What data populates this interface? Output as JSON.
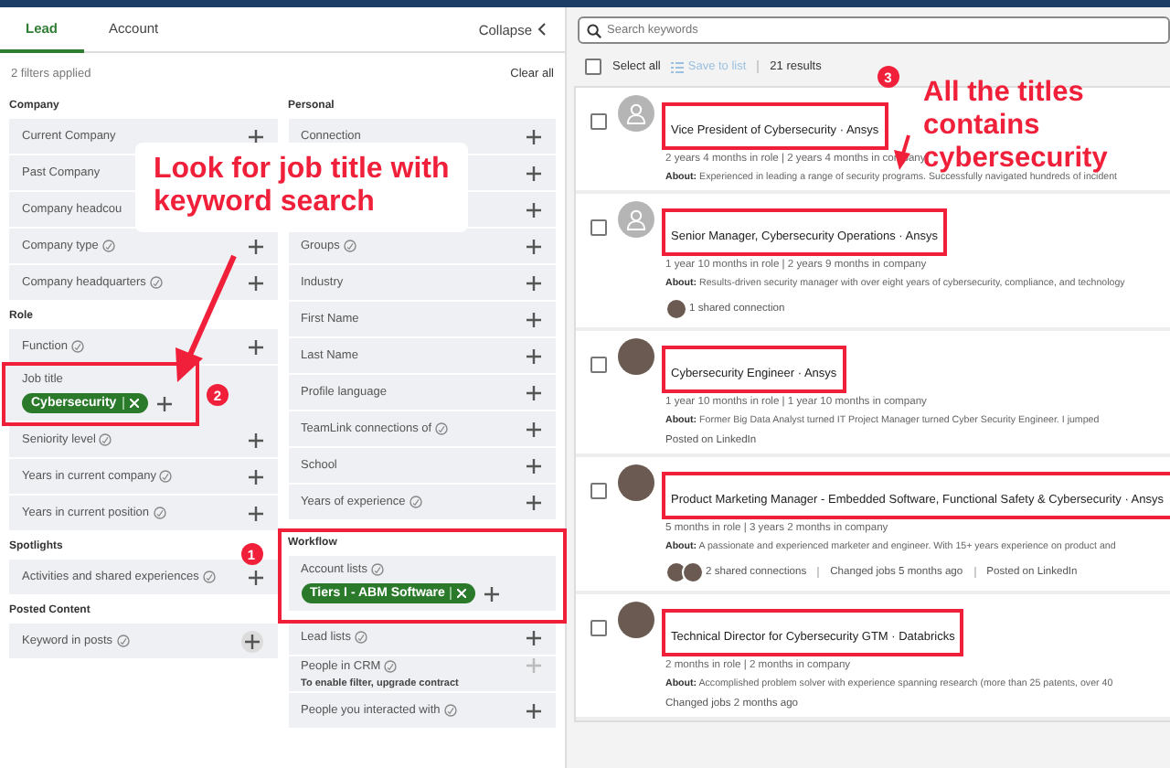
{
  "tabs": [
    {
      "label": "Lead",
      "selected": true
    },
    {
      "label": "Account",
      "selected": false
    }
  ],
  "collapse": "Collapse",
  "filters_applied": "2 filters applied",
  "clear_all": "Clear all",
  "left_column": [
    {
      "heading": "Company",
      "items": [
        {
          "label": "Current Company",
          "info": false
        },
        {
          "label": "Past Company",
          "info": false
        },
        {
          "label": "Company headcou",
          "info": false
        },
        {
          "label": "Company type",
          "info": true
        },
        {
          "label": "Company headquarters",
          "info": true
        }
      ]
    },
    {
      "heading": "Role",
      "items": [
        {
          "label": "Function",
          "info": true
        },
        {
          "label": "Job title",
          "info": false,
          "chips": [
            "Cybersecurity"
          ],
          "highlighted": true,
          "badge": "2"
        },
        {
          "label": "Seniority level",
          "info": true
        },
        {
          "label": "Years in current company",
          "info": true
        },
        {
          "label": "Years in current position",
          "info": true
        }
      ]
    },
    {
      "heading": "Spotlights",
      "items": [
        {
          "label": "Activities and shared experiences",
          "info": true
        }
      ]
    },
    {
      "heading": "Posted Content",
      "items": [
        {
          "label": "Keyword in posts",
          "info": true,
          "round_plus": true
        }
      ]
    }
  ],
  "right_column": [
    {
      "heading": "Personal",
      "items": [
        {
          "label": "Connection",
          "info": false
        },
        {
          "info": false
        },
        {
          "info": false
        },
        {
          "label": "Groups",
          "info": true
        },
        {
          "label": "Industry",
          "info": false
        },
        {
          "label": "First Name",
          "info": false
        },
        {
          "label": "Last Name",
          "info": false
        },
        {
          "label": "Profile language",
          "info": false
        },
        {
          "label": "TeamLink connections of",
          "info": true
        },
        {
          "label": "School",
          "info": false
        },
        {
          "label": "Years of experience",
          "info": true
        }
      ]
    },
    {
      "heading": "Workflow",
      "highlighted": true,
      "badge": "1",
      "items": [
        {
          "label": "Account lists",
          "info": true,
          "chips": [
            "Tiers I - ABM Software"
          ]
        },
        {
          "label": "Lead lists",
          "info": true
        },
        {
          "label": "People in CRM",
          "info": true,
          "disabled": true,
          "note": "To enable filter, upgrade contract"
        },
        {
          "label": "People you interacted with",
          "info": true
        }
      ]
    }
  ],
  "callout_left": "Look for job title with keyword search",
  "search": {
    "placeholder": "Search keywords"
  },
  "toolbar": {
    "select_all": "Select all",
    "checked": false,
    "save_to_list": "Save to list",
    "save_disabled": true,
    "results": "21 results"
  },
  "callout_right": "All the titles contains cybersecurity",
  "results": [
    {
      "avatar": {
        "kind": "generic"
      },
      "checked": false,
      "title": "Vice President of Cybersecurity · Ansys",
      "highlighted": true,
      "badge": "3",
      "tenure": "2 years 4 months in role | 2 years 4 months in company",
      "about": "**About:** Experienced in leading a range of security programs. Successfully navigated hundreds of incident"
    },
    {
      "avatar": {
        "kind": "generic"
      },
      "checked": false,
      "title": "Senior Manager, Cybersecurity Operations · Ansys",
      "highlighted": true,
      "tenure": "1 year 10 months in role | 2 years 9 months in company",
      "about": "**About:** Results-driven security manager with over eight years of cybersecurity, compliance, and technology",
      "footer": [
        {
          "kind": "connections",
          "avatars": [
            {
              "kind": "photo"
            }
          ],
          "text": "1 shared connection"
        }
      ]
    },
    {
      "avatar": {
        "kind": "photo"
      },
      "checked": false,
      "title": "Cybersecurity Engineer · Ansys",
      "highlighted": true,
      "tenure": "1 year 10 months in role | 1 year 10 months in company",
      "about": "**About:** Former Big Data Analyst turned IT Project Manager turned Cyber Security Engineer. I jumped",
      "footer": [
        {
          "kind": "text",
          "text": "Posted on LinkedIn"
        }
      ]
    },
    {
      "avatar": {
        "kind": "photo"
      },
      "checked": false,
      "title": "Product Marketing Manager - Embedded Software, Functional Safety & Cybersecurity · Ansys",
      "highlighted": true,
      "tenure": "5 months in role | 3 years 2 months in company",
      "about": "**About:** A passionate and experienced marketer and engineer. With 15+ years experience on product and",
      "footer": [
        {
          "kind": "connections",
          "avatars": [
            {
              "kind": "photo"
            },
            {
              "kind": "photo"
            }
          ],
          "text": "2 shared connections"
        },
        {
          "kind": "text",
          "text": "Changed jobs 5 months ago"
        },
        {
          "kind": "text",
          "text": "Posted on LinkedIn"
        }
      ]
    },
    {
      "avatar": {
        "kind": "photo"
      },
      "checked": false,
      "title": "Technical Director for Cybersecurity GTM · Databricks",
      "highlighted": true,
      "tenure": "2 months in role | 2 months in company",
      "about": "**About:** Accomplished problem solver with experience spanning research (more than 25 patents, over 40",
      "footer": [
        {
          "kind": "text",
          "text": "Changed jobs 2 months ago"
        }
      ]
    }
  ]
}
